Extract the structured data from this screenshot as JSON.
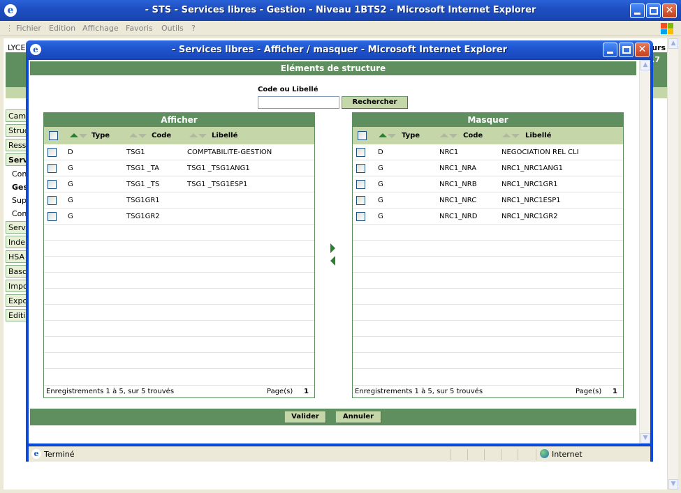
{
  "outer_window": {
    "title": "- STS - Services libres - Gestion - Niveau 1BTS2 - Microsoft Internet Explorer",
    "menu": [
      "Fichier",
      "Edition",
      "Affichage",
      "Favoris",
      "Outils",
      "?"
    ],
    "bg_left_text": "LYCE",
    "bg_right_text": "urs",
    "bg_right_text2": ".7",
    "sidebar": [
      "Cam",
      "Struc",
      "Ress",
      "Serv",
      "Con",
      "Ges",
      "Sup",
      "Con",
      "Serv",
      "Inde",
      "HSA",
      "Basc",
      "Impo",
      "Expo",
      "Editi"
    ]
  },
  "popup": {
    "title": "- Services libres - Afficher / masquer - Microsoft Internet Explorer",
    "section_title": "Eléments de structure",
    "search": {
      "label": "Code ou Libellé",
      "value": "",
      "button": "Rechercher"
    },
    "columns": {
      "type": "Type",
      "code": "Code",
      "libelle": "Libellé"
    },
    "afficher": {
      "title": "Afficher",
      "rows": [
        {
          "type": "D",
          "code": "TSG1",
          "libelle": "COMPTABILITE-GESTION"
        },
        {
          "type": "G",
          "code": "TSG1 _TA",
          "libelle": "TSG1 _TSG1ANG1"
        },
        {
          "type": "G",
          "code": "TSG1 _TS",
          "libelle": "TSG1 _TSG1ESP1"
        },
        {
          "type": "G",
          "code": "TSG1GR1",
          "libelle": ""
        },
        {
          "type": "G",
          "code": "TSG1GR2",
          "libelle": ""
        }
      ],
      "footer": "Enregistrements 1 à 5, sur 5 trouvés",
      "pages_label": "Page(s)",
      "page": "1"
    },
    "masquer": {
      "title": "Masquer",
      "rows": [
        {
          "type": "D",
          "code": "NRC1",
          "libelle": "NEGOCIATION REL CLI"
        },
        {
          "type": "G",
          "code": "NRC1_NRA",
          "libelle": "NRC1_NRC1ANG1"
        },
        {
          "type": "G",
          "code": "NRC1_NRB",
          "libelle": "NRC1_NRC1GR1"
        },
        {
          "type": "G",
          "code": "NRC1_NRC",
          "libelle": "NRC1_NRC1ESP1"
        },
        {
          "type": "G",
          "code": "NRC1_NRD",
          "libelle": "NRC1_NRC1GR2"
        }
      ],
      "footer": "Enregistrements 1 à 5, sur 5 trouvés",
      "pages_label": "Page(s)",
      "page": "1"
    },
    "buttons": {
      "valider": "Valider",
      "annuler": "Annuler"
    },
    "status": {
      "text": "Terminé",
      "zone": "Internet"
    }
  },
  "colors": {
    "header_green": "#5f8e5f",
    "light_green": "#c5d7a9",
    "xp_blue": "#0a49d9"
  }
}
